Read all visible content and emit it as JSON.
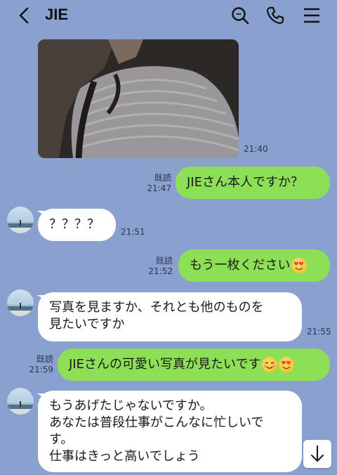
{
  "header": {
    "title": "JIE"
  },
  "messages": [
    {
      "id": 0,
      "type": "image",
      "time": "21:40"
    },
    {
      "id": 1,
      "dir": "out",
      "read": "既読",
      "time": "21:47",
      "text": "JIEさん本人ですか？"
    },
    {
      "id": 2,
      "dir": "in",
      "time": "21:51",
      "text": "？？？？"
    },
    {
      "id": 3,
      "dir": "out",
      "read": "既読",
      "time": "21:52",
      "text": "もう一枚ください",
      "emoji": "heart-eyes-emoji"
    },
    {
      "id": 4,
      "dir": "in",
      "time": "21:55",
      "lines": [
        "写真を見ますか、それとも他のものを",
        "見たいですか"
      ]
    },
    {
      "id": 5,
      "dir": "out",
      "read": "既読",
      "time": "21:59",
      "text": "JIEさんの可愛い写真が見たいです",
      "emoji": [
        "blush-emoji",
        "heart-eyes-emoji"
      ]
    },
    {
      "id": 6,
      "dir": "in",
      "lines": [
        "もうあげたじゃないですか。",
        "あなたは普段仕事がこんなに忙しいで",
        "す。",
        "仕事はきっと高いでしょう"
      ]
    }
  ],
  "icons": [
    "back-icon",
    "search-icon",
    "phone-icon",
    "menu-icon",
    "scroll-down-icon"
  ],
  "colors": {
    "background": "#8aa0cf",
    "outgoing_bubble": "#8de055",
    "incoming_bubble": "#ffffff"
  }
}
